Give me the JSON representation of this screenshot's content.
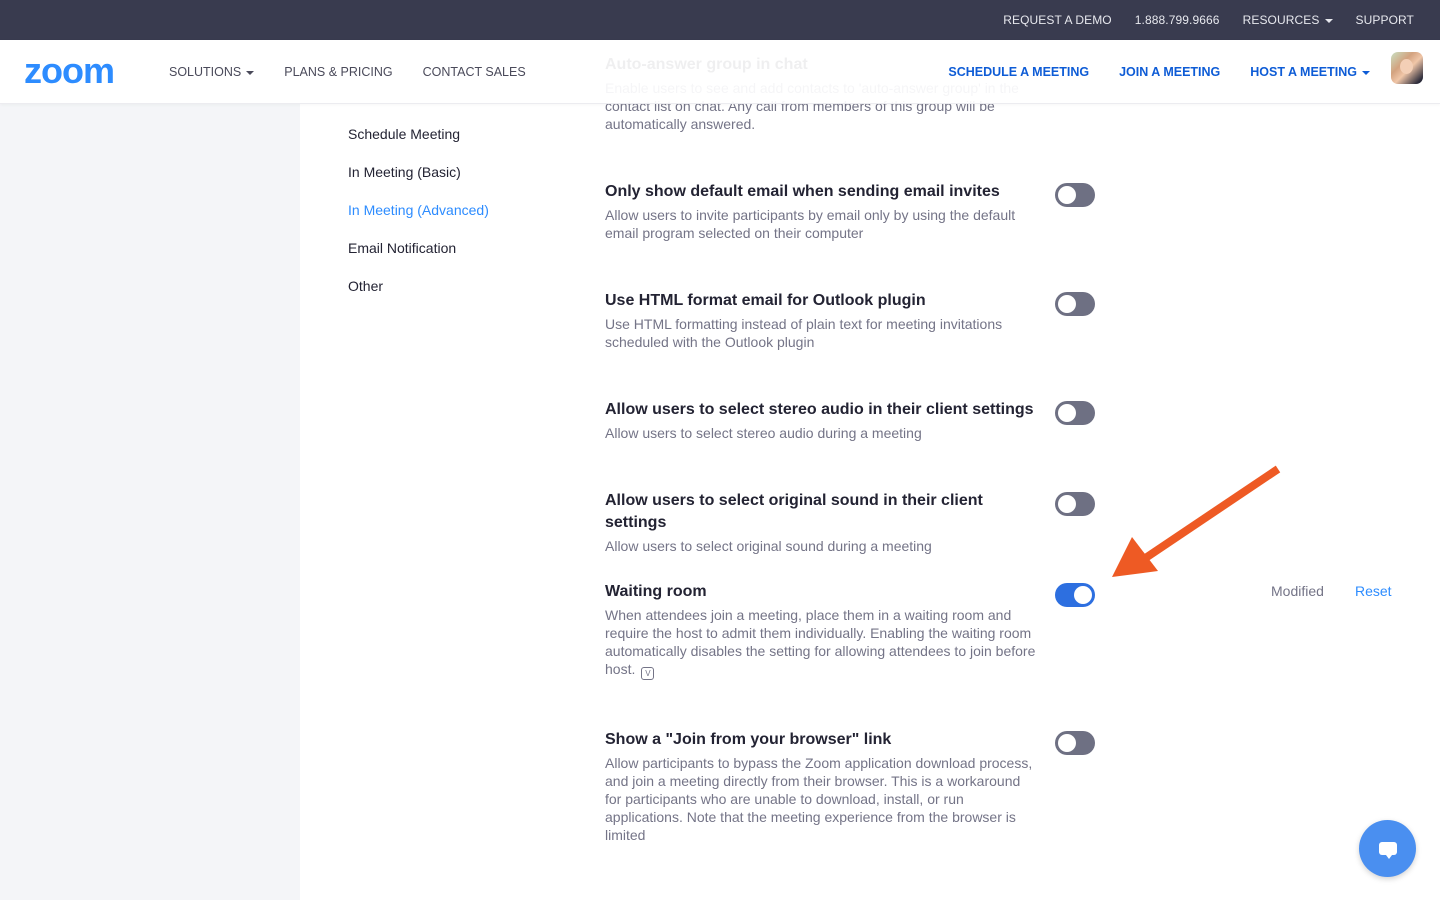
{
  "topbar": {
    "links": [
      {
        "label": "REQUEST A DEMO"
      },
      {
        "label": "1.888.799.9666"
      },
      {
        "label": "RESOURCES",
        "dropdown": true
      },
      {
        "label": "SUPPORT"
      }
    ]
  },
  "header": {
    "logo": "zoom",
    "nav_left": [
      {
        "label": "SOLUTIONS",
        "dropdown": true
      },
      {
        "label": "PLANS & PRICING"
      },
      {
        "label": "CONTACT SALES"
      }
    ],
    "nav_right": [
      {
        "label": "SCHEDULE A MEETING"
      },
      {
        "label": "JOIN A MEETING"
      },
      {
        "label": "HOST A MEETING",
        "dropdown": true
      }
    ],
    "avatar_icon": "user-avatar"
  },
  "sidenav": {
    "items": [
      {
        "label": "Schedule Meeting",
        "active": false
      },
      {
        "label": "In Meeting (Basic)",
        "active": false
      },
      {
        "label": "In Meeting (Advanced)",
        "active": true
      },
      {
        "label": "Email Notification",
        "active": false
      },
      {
        "label": "Other",
        "active": false
      }
    ]
  },
  "settings": [
    {
      "title": "Auto-answer group in chat",
      "description": "Enable users to see and add contacts to 'auto-answer group' in the contact list on chat. Any call from members of this group will be automatically answered.",
      "partially_hidden": true
    },
    {
      "title": "Only show default email when sending email invites",
      "description": "Allow users to invite participants by email only by using the default email program selected on their computer",
      "enabled": false
    },
    {
      "title": "Use HTML format email for Outlook plugin",
      "description": "Use HTML formatting instead of plain text for meeting invitations scheduled with the Outlook plugin",
      "enabled": false
    },
    {
      "title": "Allow users to select stereo audio in their client settings",
      "description": "Allow users to select stereo audio during a meeting",
      "enabled": false
    },
    {
      "title": "Allow users to select original sound in their client settings",
      "description": "Allow users to select original sound during a meeting",
      "enabled": false
    },
    {
      "title": "Waiting room",
      "description": "When attendees join a meeting, place them in a waiting room and require the host to admit them individually. Enabling the waiting room automatically disables the setting for allowing attendees to join before host.",
      "info_icon_label": "V",
      "enabled": true,
      "status": "Modified",
      "reset_label": "Reset"
    },
    {
      "title": "Show a \"Join from your browser\" link",
      "description": "Allow participants to bypass the Zoom application download process, and join a meeting directly from their browser. This is a workaround for participants who are unable to download, install, or run applications. Note that the meeting experience from the browser is limited",
      "enabled": false
    }
  ],
  "annotation": {
    "type": "arrow",
    "color": "#ee5a24",
    "points_to": "Waiting room toggle"
  },
  "chat_button": {
    "icon": "chat-bubble-icon",
    "color": "#4a8ff0"
  }
}
